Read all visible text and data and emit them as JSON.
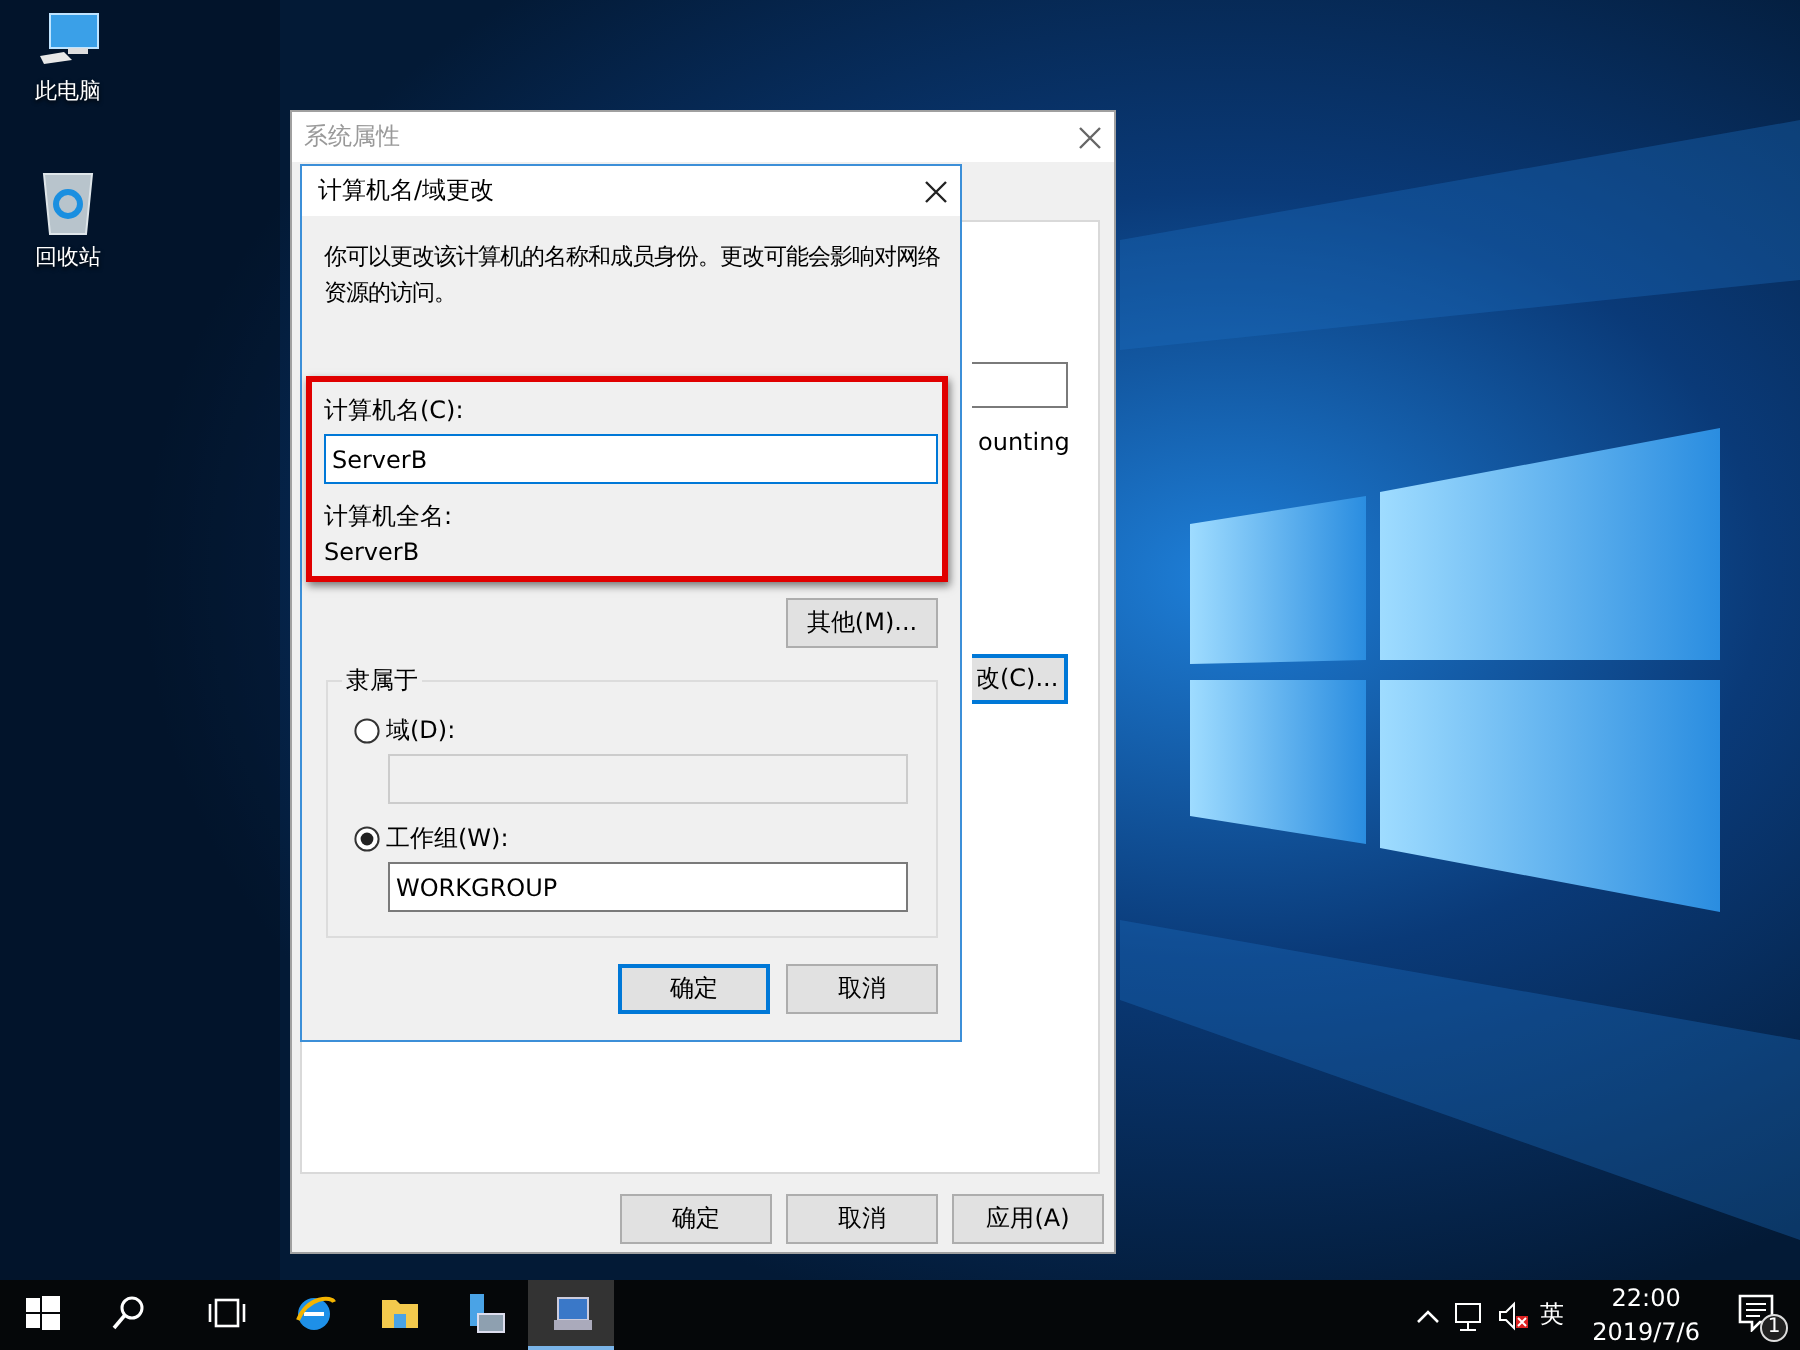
{
  "desktop_icons": [
    {
      "kind": "computer",
      "label": "此电脑"
    },
    {
      "kind": "recycle",
      "label": "回收站"
    }
  ],
  "system_properties": {
    "title": "系统属性",
    "background_text": "ounting",
    "background_button": "改(C)...",
    "buttons": [
      "确定",
      "取消",
      "应用(A)"
    ]
  },
  "name_dialog": {
    "title": "计算机名/域更改",
    "description": "你可以更改该计算机的名称和成员身份。更改可能会影响对网络资源的访问。",
    "computer_name_label": "计算机名(C):",
    "computer_name": "ServerB",
    "full_name_label": "计算机全名:",
    "full_name": "ServerB",
    "more_button": "其他(M)...",
    "member_of": {
      "title": "隶属于",
      "options": [
        {
          "label": "域(D):",
          "selected": false
        },
        {
          "label": "工作组(W):",
          "selected": true,
          "value": "WORKGROUP"
        }
      ]
    },
    "buttons": [
      {
        "label": "确定",
        "default": true
      },
      {
        "label": "取消",
        "default": false
      }
    ]
  },
  "taskbar": {
    "items": [
      {
        "kind": "start",
        "selected": false
      },
      {
        "kind": "search",
        "selected": false
      },
      {
        "kind": "taskview",
        "selected": false
      },
      {
        "kind": "browser",
        "selected": false
      },
      {
        "kind": "folder",
        "selected": false
      },
      {
        "kind": "server",
        "selected": false
      },
      {
        "kind": "sysprops",
        "selected": true
      }
    ],
    "tray": {
      "language": "英",
      "time": "22:00",
      "date": "2019/7/6",
      "notification_count": "1"
    }
  }
}
